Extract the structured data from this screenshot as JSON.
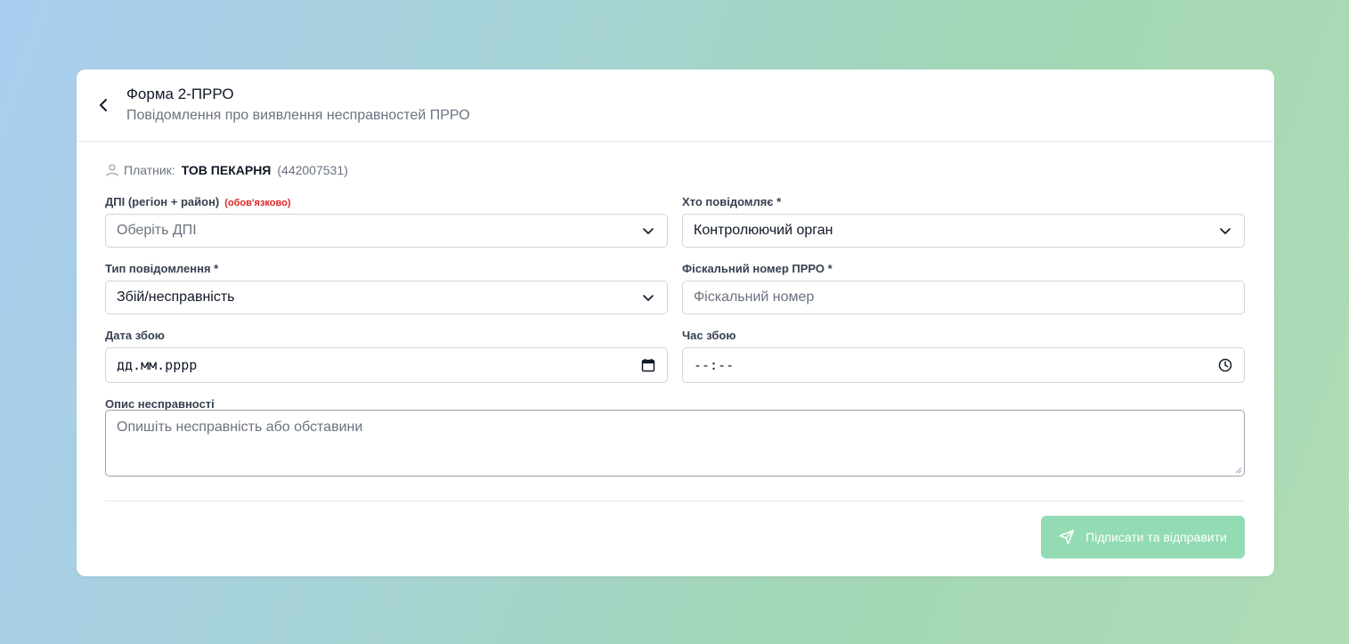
{
  "header": {
    "title": "Форма 2-ПРРО",
    "subtitle": "Повідомлення про виявлення несправностей ПРРО"
  },
  "payer": {
    "label": "Платник:",
    "name": "ТОВ ПЕКАРНЯ",
    "code": "(442007531)"
  },
  "form": {
    "dpi": {
      "label": "ДПІ (регіон + район)",
      "required_note": "(обов'язково)",
      "placeholder": "Оберіть ДПІ"
    },
    "reporter": {
      "label": "Хто повідомляє *",
      "value": "Контролюючий орган"
    },
    "message_type": {
      "label": "Тип повідомлення *",
      "value": "Збій/несправність"
    },
    "fiscal_number": {
      "label": "Фіскальний номер ПРРО *",
      "placeholder": "Фіскальний номер"
    },
    "failure_date": {
      "label": "Дата збою",
      "placeholder": "дд.мм.рррр"
    },
    "failure_time": {
      "label": "Час збою",
      "placeholder": "--:--"
    },
    "description": {
      "label": "Опис несправності",
      "placeholder": "Опишіть несправність або обставини"
    }
  },
  "actions": {
    "submit_label": "Підписати та відправити"
  },
  "colors": {
    "accent": "#93dbb3",
    "required": "#dc2626"
  }
}
